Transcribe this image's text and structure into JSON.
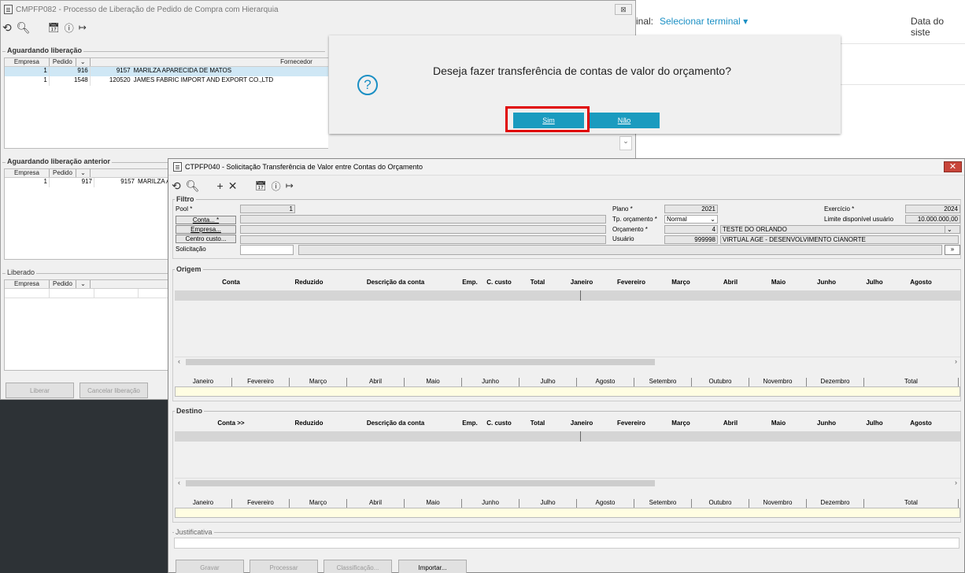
{
  "web": {
    "terminal_prefix": "inal:",
    "terminal_link": "Selecionar terminal",
    "data_label": "Data do siste"
  },
  "w1": {
    "title": "CMPFP082 - Processo de Liberação de Pedido de Compra com Hierarquia",
    "close": "⊠",
    "grp_aguardando": "Aguardando liberação",
    "cols": [
      "Empresa",
      "Pedido",
      "",
      "Fornecedor"
    ],
    "rows": [
      {
        "empresa": "1",
        "pedido": "916",
        "forn_cod": "9157",
        "forn_nome": "MARILZA APARECIDA DE MATOS"
      },
      {
        "empresa": "1",
        "pedido": "1548",
        "forn_cod": "120520",
        "forn_nome": "JAMES FABRIC IMPORT AND EXPORT CO.,LTD"
      }
    ],
    "grp_anterior": "Aguardando liberação anterior",
    "cols2": [
      "Empresa",
      "Pedido",
      ""
    ],
    "row2": {
      "empresa": "1",
      "pedido": "917",
      "forn_cod": "9157",
      "forn_nome": "MARILZA A"
    },
    "grp_liberado": "Liberado",
    "cols3": [
      "Empresa",
      "Pedido",
      ""
    ],
    "btn_liberar": "Liberar",
    "btn_cancelar": "Cancelar liberação"
  },
  "dialog": {
    "message": "Deseja fazer transferência de contas de valor do orçamento?",
    "yes": "Sim",
    "no": "Não",
    "icon": "?"
  },
  "w2": {
    "title": "CTPFP040 - Solicitação Transferência de Valor entre Contas do Orçamento",
    "close": "✕",
    "filtro": "Filtro",
    "pool_label": "Pool *",
    "pool_value": "1",
    "conta_btn": "Conta... *",
    "empresa_btn": "Empresa...",
    "centro_btn": "Centro custo...",
    "solicitacao": "Solicitação",
    "plano_label": "Plano *",
    "plano_value": "2021",
    "tp_label": "Tp. orçamento *",
    "tp_value": "Normal",
    "orc_label": "Orçamento *",
    "orc_cod": "4",
    "orc_nome": "TESTE DO ORLANDO",
    "usuario_label": "Usuário",
    "usuario_cod": "999998",
    "usuario_nome": "VIRTUAL AGE - DESENVOLVIMENTO CIANORTE",
    "exercicio_label": "Exercício *",
    "exercicio_value": "2024",
    "limite_label": "Limite disponível usuário",
    "limite_value": "10.000.000,00",
    "more_btn": "»",
    "origem": "Origem",
    "destino": "Destino",
    "origem_cols": [
      "Conta",
      "Reduzido",
      "Descrição da conta",
      "Emp.",
      "C. custo",
      "Total",
      "Janeiro",
      "Fevereiro",
      "Março",
      "Abril",
      "Maio",
      "Junho",
      "Julho",
      "Agosto"
    ],
    "destino_cols": [
      "Conta  >>",
      "Reduzido",
      "Descrição da conta",
      "Emp.",
      "C. custo",
      "Total",
      "Janeiro",
      "Fevereiro",
      "Março",
      "Abril",
      "Maio",
      "Junho",
      "Julho",
      "Agosto"
    ],
    "months": [
      "Janeiro",
      "Fevereiro",
      "Março",
      "Abril",
      "Maio",
      "Junho",
      "Julho",
      "Agosto",
      "Setembro",
      "Outubro",
      "Novembro",
      "Dezembro",
      "Total"
    ],
    "justificativa": "Justificativa",
    "btn_gravar": "Gravar",
    "btn_processar": "Processar",
    "btn_class": "Classificação...",
    "btn_importar": "Importar..."
  },
  "colors": {
    "accent": "#1a9bbf",
    "highlight": "#e00000",
    "selected_row": "#cfe7f5",
    "total_row": "#fffde2"
  }
}
